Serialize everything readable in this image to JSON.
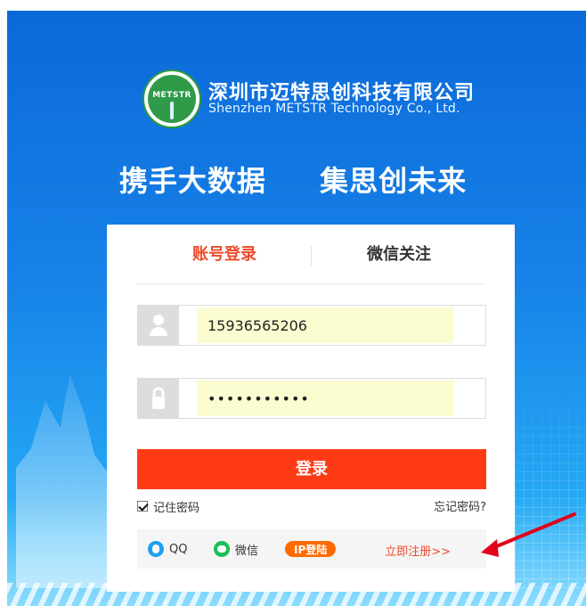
{
  "brand": {
    "logo_text": "METSTR",
    "company_cn": "深圳市迈特思创科技有限公司",
    "company_en": "Shenzhen METSTR Technology Co., Ltd."
  },
  "slogan": {
    "part1": "携手大数据",
    "part2": "集思创未来"
  },
  "tabs": [
    {
      "label": "账号登录"
    },
    {
      "label": "微信关注"
    }
  ],
  "form": {
    "username_value": "15936565206",
    "password_value": "•••••••••••",
    "login_label": "登录",
    "remember_label": "记住密码",
    "forgot_label": "忘记密码?"
  },
  "social": {
    "qq_label": "QQ",
    "wechat_label": "微信",
    "ip_label": "IP登陆",
    "register_label": "立即注册>>"
  },
  "colors": {
    "primary_red": "#ff3b16",
    "tab_active": "#f04a2a",
    "input_autofill": "#fbfccf",
    "background_blue": "#0b69d8"
  }
}
